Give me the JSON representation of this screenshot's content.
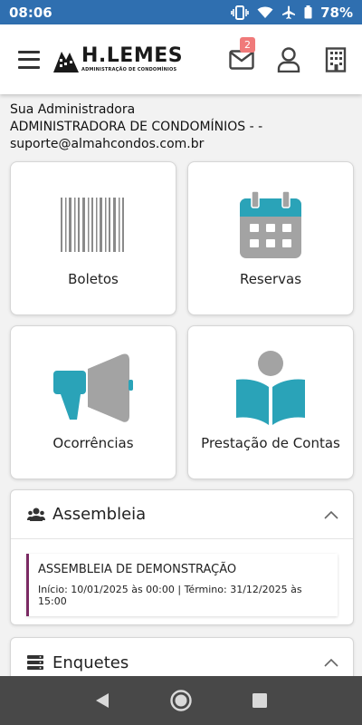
{
  "status_bar": {
    "time": "08:06",
    "battery": "78%",
    "icons": [
      "vibrate-icon",
      "wifi-icon",
      "airplane-icon",
      "battery-icon"
    ]
  },
  "header": {
    "logo_name": "H.LEMES",
    "logo_subtitle": "ADMINISTRAÇÃO DE CONDOMÍNIOS",
    "mail_badge": "2",
    "icons": [
      "menu-icon",
      "mail-icon",
      "user-icon",
      "building-icon"
    ]
  },
  "info": {
    "label": "Sua Administradora",
    "name": "ADMINISTRADORA DE CONDOMÍNIOS - -",
    "email": "suporte@almahcondos.com.br"
  },
  "tiles": [
    {
      "label": "Boletos",
      "icon": "barcode-icon"
    },
    {
      "label": "Reservas",
      "icon": "calendar-icon"
    },
    {
      "label": "Ocorrências",
      "icon": "megaphone-icon"
    },
    {
      "label": "Prestação de Contas",
      "icon": "reading-person-icon"
    }
  ],
  "assembleia": {
    "title": "Assembleia",
    "event_title": "ASSEMBLEIA DE DEMONSTRAÇÃO",
    "event_dates": "Início: 10/01/2025 às 00:00 | Término: 31/12/2025 às 15:00"
  },
  "enquetes": {
    "title": "Enquetes"
  },
  "colors": {
    "status_bar": "#2f6fb0",
    "accent_teal": "#2aa3b8",
    "event_border": "#7b2a63",
    "badge": "#f07a7a",
    "nav_bar": "#484848"
  }
}
